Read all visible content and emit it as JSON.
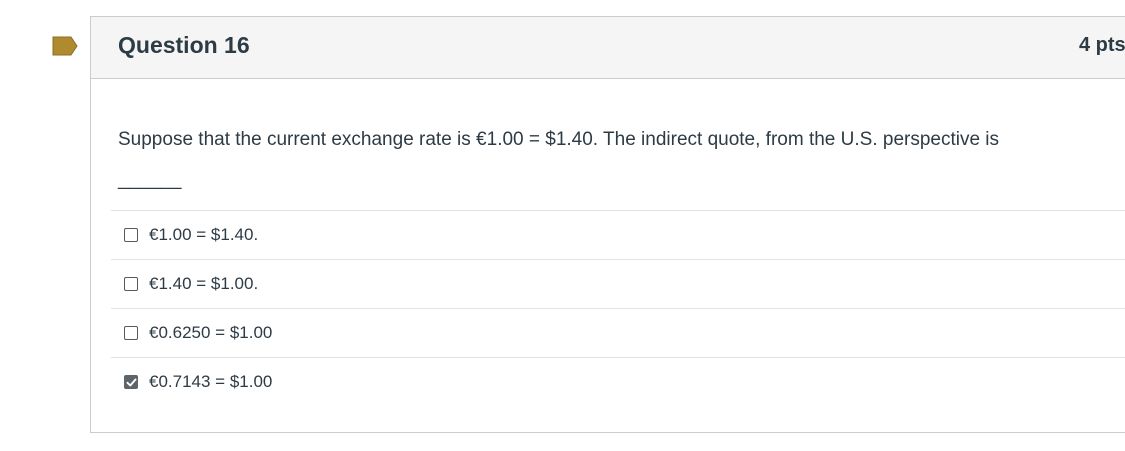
{
  "question": {
    "title": "Question 16",
    "points": "4 pts",
    "text": "Suppose that the current exchange rate is €1.00 = $1.40. The indirect quote, from the U.S. perspective is\n______",
    "flag_color": "#b08a2e"
  },
  "answers": [
    {
      "label": "€1.00 = $1.40.",
      "checked": false
    },
    {
      "label": "€1.40 = $1.00.",
      "checked": false
    },
    {
      "label": "€0.6250 = $1.00",
      "checked": false
    },
    {
      "label": "€0.7143 = $1.00",
      "checked": true
    }
  ]
}
